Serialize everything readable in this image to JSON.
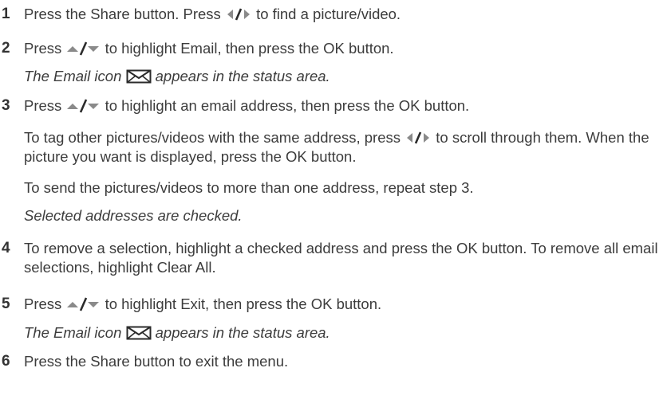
{
  "colors": {
    "text": "#3c3c3c",
    "number": "#333333",
    "icon_gray": "#8a8a8a",
    "icon_dark": "#2b2b2b"
  },
  "icons": {
    "left_right": "left-right-arrows-icon",
    "up_down": "up-down-arrows-icon",
    "email": "envelope-icon"
  },
  "steps": [
    {
      "number": "1",
      "text_a": "Press the Share button. Press ",
      "text_b": " to find a picture/video."
    },
    {
      "number": "2",
      "text_a": "Press ",
      "text_b": " to highlight Email, then press the OK button.",
      "note_a": "The Email icon ",
      "note_b": "appears in the status area."
    },
    {
      "number": "3",
      "text_a": "Press ",
      "text_b": " to highlight an email address, then press the OK button.",
      "para1_a": "To tag other pictures/videos with the same address, press ",
      "para1_b": " to scroll through them. When the picture you want is displayed, press the OK button.",
      "para2": "To send the pictures/videos to more than one address, repeat step 3.",
      "note": "Selected addresses are checked."
    },
    {
      "number": "4",
      "text": "To remove a selection, highlight a checked address and press the OK button. To remove all email selections, highlight Clear All."
    },
    {
      "number": "5",
      "text_a": "Press ",
      "text_b": " to highlight Exit, then press the OK button.",
      "note_a": "The Email icon ",
      "note_b": "appears in the status area."
    },
    {
      "number": "6",
      "text": "Press the Share button to exit the menu."
    }
  ]
}
